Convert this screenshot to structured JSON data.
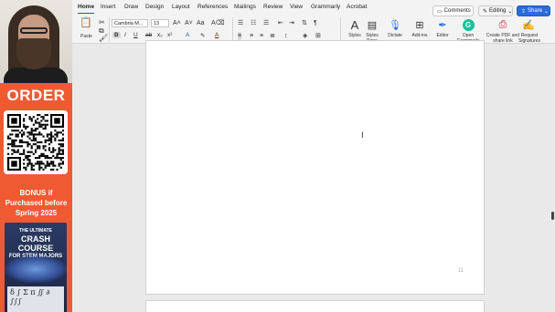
{
  "promo": {
    "order_label": "ORDER",
    "bonus_label": "BONUS if Purchased before Spring 2025",
    "book": {
      "top_line": "THE ULTIMATE",
      "title": "CRASH COURSE",
      "subtitle": "FOR STEM MAJORS",
      "symbols": "δ ∫ Σ π ∬ ∂ ∫∫∫"
    }
  },
  "ribbon": {
    "tabs": [
      "Home",
      "Insert",
      "Draw",
      "Design",
      "Layout",
      "References",
      "Mailings",
      "Review",
      "View",
      "Grammarly",
      "Acrobat"
    ],
    "active_tab": "Home",
    "comments_label": "Comments",
    "editing_label": "Editing",
    "share_label": "Share",
    "paste_label": "Paste",
    "font_name": "Cambria M...",
    "font_size": "13",
    "styles_label": "Styles",
    "styles_pane_label": "Styles Pane",
    "dictate_label": "Dictate",
    "addins_label": "Add-ins",
    "editor_label": "Editor",
    "open_grammarly_label": "Open Grammarly",
    "create_pdf_label": "Create PDF and share link",
    "request_signatures_label": "Request Signatures"
  },
  "document": {
    "page_number": "11"
  },
  "colors": {
    "promo_bg": "#ef5a33",
    "share_bg": "#2b6cd8",
    "grammarly": "#15c39a"
  }
}
